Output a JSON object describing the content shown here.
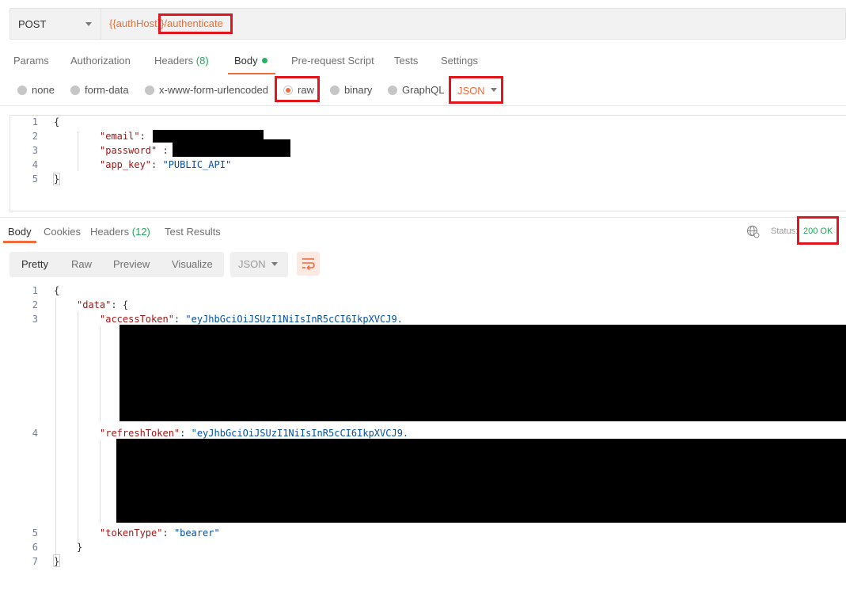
{
  "request": {
    "method": "POST",
    "url_host": "{{authHost}}",
    "url_path": "/authenticate"
  },
  "request_tabs": {
    "params": "Params",
    "authorization": "Authorization",
    "headers": "Headers",
    "headers_count": "(8)",
    "body": "Body",
    "prerequest": "Pre-request Script",
    "tests": "Tests",
    "settings": "Settings"
  },
  "body_types": {
    "none": "none",
    "form_data": "form-data",
    "urlencoded": "x-www-form-urlencoded",
    "raw": "raw",
    "binary": "binary",
    "graphql": "GraphQL",
    "format": "JSON",
    "selected": "raw"
  },
  "request_body": {
    "line_numbers": [
      "1",
      "2",
      "3",
      "4",
      "5"
    ],
    "open_brace": "{",
    "close_brace": "}",
    "email_key": "\"email\"",
    "password_key": "\"password\"",
    "app_key_key": "\"app_key\"",
    "app_key_value": "\"PUBLIC_API\""
  },
  "response_tabs": {
    "body": "Body",
    "cookies": "Cookies",
    "headers": "Headers",
    "headers_count": "(12)",
    "test_results": "Test Results"
  },
  "response_status": {
    "label": "Status:",
    "value": "200 OK"
  },
  "view_modes": {
    "pretty": "Pretty",
    "raw": "Raw",
    "preview": "Preview",
    "visualize": "Visualize",
    "format": "JSON"
  },
  "response_body": {
    "line_numbers": [
      "1",
      "2",
      "3",
      "4",
      "5",
      "6",
      "7"
    ],
    "open_brace": "{",
    "data_key": "\"data\"",
    "data_open": "{",
    "access_key": "\"accessToken\"",
    "access_value": "\"eyJhbGciOiJSUzI1NiIsInR5cCI6IkpXVCJ9.",
    "refresh_key": "\"refreshToken\"",
    "refresh_value": "\"eyJhbGciOiJSUzI1NiIsInR5cCI6IkpXVCJ9.",
    "type_key": "\"tokenType\"",
    "type_value": "\"bearer\"",
    "data_close": "}",
    "close_brace": "}"
  },
  "colors": {
    "accent": "#f26b3a",
    "highlight": "#e2141c",
    "success": "#26a35a"
  }
}
